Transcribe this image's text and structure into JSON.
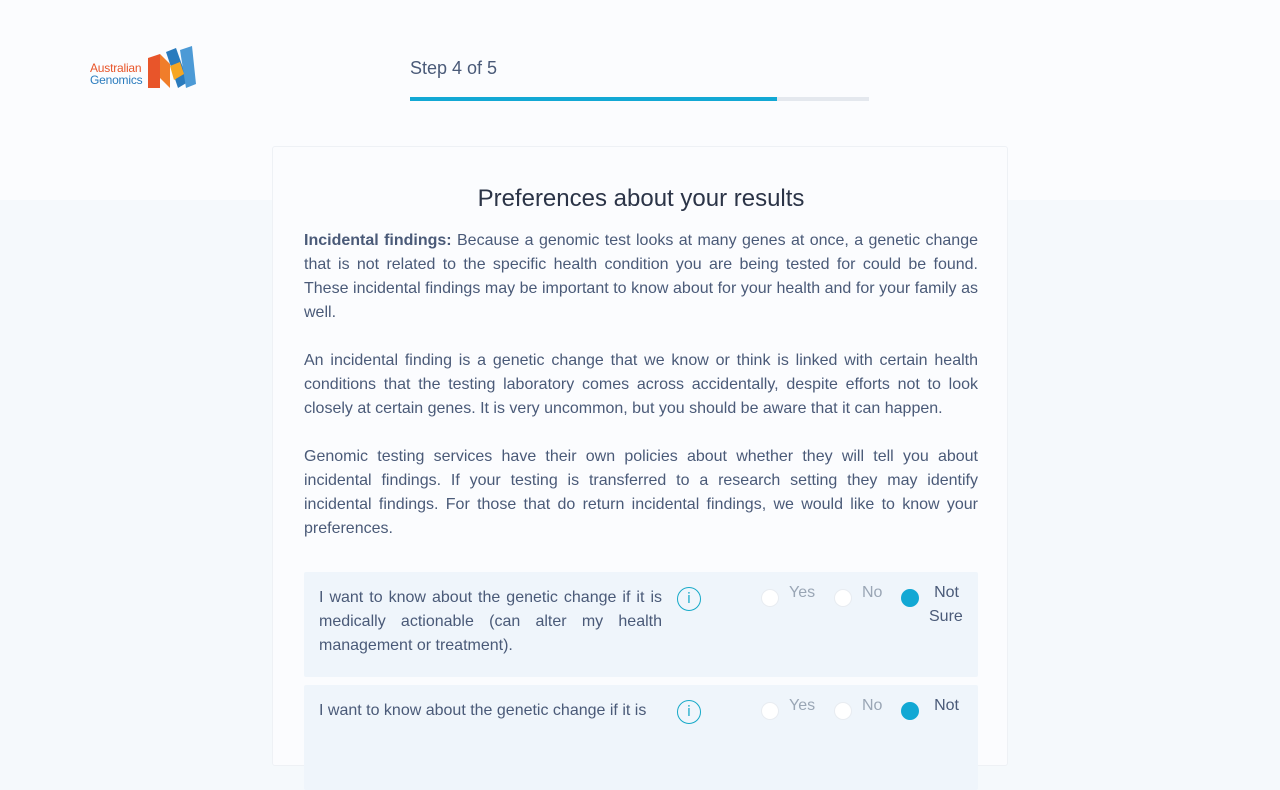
{
  "brand": {
    "name_line1": "Australian",
    "name_line2": "Genomics"
  },
  "progress": {
    "step_label": "Step 4 of 5",
    "fraction": 0.8
  },
  "card": {
    "title": "Preferences about your results",
    "intro_bold": "Incidental findings:",
    "intro_text": " Because a genomic test looks at many genes at once, a genetic change that is not related to the specific health condition you are being tested for could be found. These incidental findings may be important to know about for your health and for your family as well.",
    "paragraph2": "An incidental finding is a genetic change that we know or think is linked with certain health conditions that the testing laboratory comes across accidentally, despite efforts not to look closely at certain genes. It is very uncommon, but you should be aware that it can happen.",
    "paragraph3": "Genomic testing services have their own policies about whether they will tell you about incidental findings. If your testing is transferred to a research setting they may identify incidental findings. For those that do return incidental findings, we would like to know your preferences."
  },
  "questions": [
    {
      "text": "I want to know about the genetic change if it is medically actionable (can alter my health management or treatment).",
      "info": "i",
      "options": [
        "Yes",
        "No",
        "Not Sure"
      ],
      "selected": "Not Sure"
    },
    {
      "text": "I want to know about the genetic change if it is",
      "info": "i",
      "options": [
        "Yes",
        "No",
        "Not"
      ],
      "selected": "Not"
    }
  ],
  "colors": {
    "accent": "#12a8d4",
    "text": "#4a5a78",
    "title": "#2b3447",
    "question_bg": "#eff5fb"
  }
}
